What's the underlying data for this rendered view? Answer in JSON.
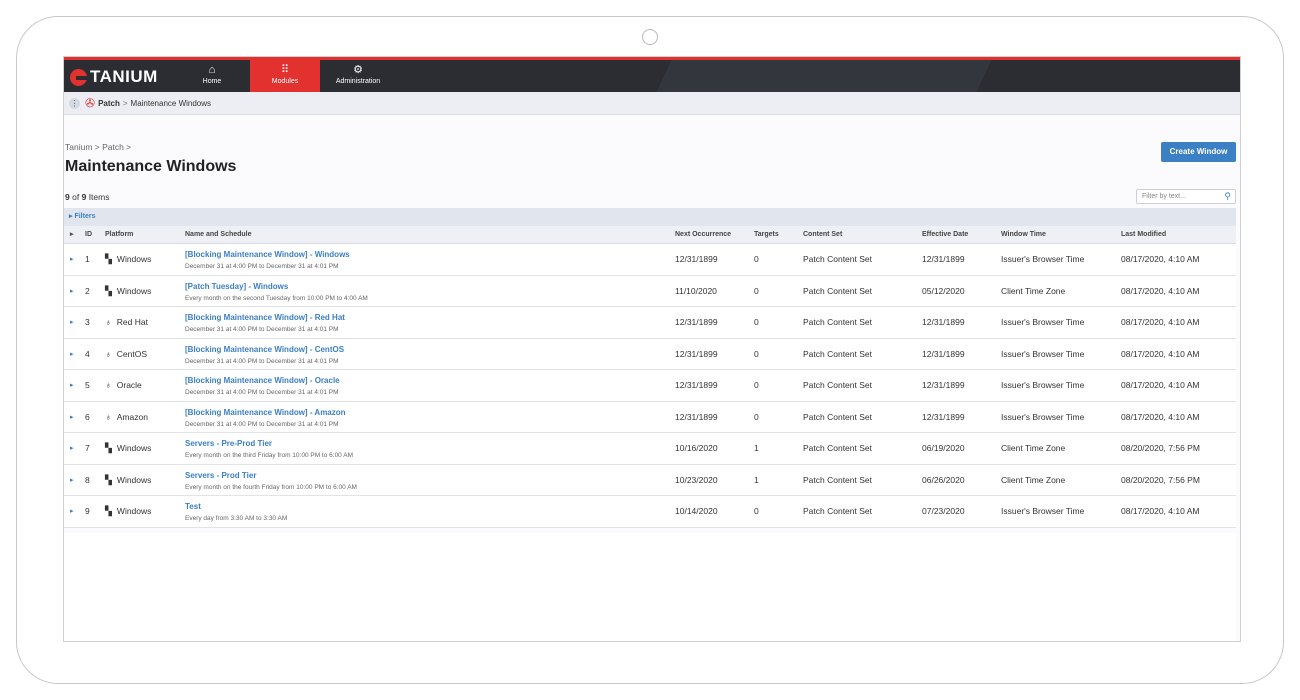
{
  "app": {
    "brand": "TANIUM"
  },
  "nav": [
    {
      "label": "Home",
      "icon": "home-icon",
      "glyph": "⌂"
    },
    {
      "label": "Modules",
      "icon": "grid-icon",
      "glyph": "⠿"
    },
    {
      "label": "Administration",
      "icon": "gears-icon",
      "glyph": "⚙"
    }
  ],
  "breadcrumb_bar": {
    "module": "Patch",
    "separator": ">",
    "page": "Maintenance Windows"
  },
  "page": {
    "breadcrumb": "Tanium > Patch >",
    "title": "Maintenance Windows",
    "create_button": "Create Window",
    "count_shown": "9",
    "count_of": "of",
    "count_total": "9",
    "count_suffix": "Items",
    "filter_placeholder": "Filter by text...",
    "filters_label": "▸ Filters"
  },
  "columns": [
    "ID",
    "Platform",
    "Name and Schedule",
    "Next Occurrence",
    "Targets",
    "Content Set",
    "Effective Date",
    "Window Time",
    "Last Modified"
  ],
  "rows": [
    {
      "id": "1",
      "platform": "Windows",
      "platform_icon": "windows-icon",
      "name": "[Blocking Maintenance Window] - Windows",
      "schedule": "December 31 at 4:00 PM to December 31 at 4:01 PM",
      "next": "12/31/1899",
      "targets": "0",
      "content_set": "Patch Content Set",
      "effective": "12/31/1899",
      "window_time": "Issuer's Browser Time",
      "modified": "08/17/2020, 4:10 AM"
    },
    {
      "id": "2",
      "platform": "Windows",
      "platform_icon": "windows-icon",
      "name": "[Patch Tuesday] - Windows",
      "schedule": "Every month on the second Tuesday from 10:00 PM to 4:00 AM",
      "next": "11/10/2020",
      "targets": "0",
      "content_set": "Patch Content Set",
      "effective": "05/12/2020",
      "window_time": "Client Time Zone",
      "modified": "08/17/2020, 4:10 AM"
    },
    {
      "id": "3",
      "platform": "Red Hat",
      "platform_icon": "linux-icon",
      "name": "[Blocking Maintenance Window] - Red Hat",
      "schedule": "December 31 at 4:00 PM to December 31 at 4:01 PM",
      "next": "12/31/1899",
      "targets": "0",
      "content_set": "Patch Content Set",
      "effective": "12/31/1899",
      "window_time": "Issuer's Browser Time",
      "modified": "08/17/2020, 4:10 AM"
    },
    {
      "id": "4",
      "platform": "CentOS",
      "platform_icon": "linux-icon",
      "name": "[Blocking Maintenance Window] - CentOS",
      "schedule": "December 31 at 4:00 PM to December 31 at 4:01 PM",
      "next": "12/31/1899",
      "targets": "0",
      "content_set": "Patch Content Set",
      "effective": "12/31/1899",
      "window_time": "Issuer's Browser Time",
      "modified": "08/17/2020, 4:10 AM"
    },
    {
      "id": "5",
      "platform": "Oracle",
      "platform_icon": "linux-icon",
      "name": "[Blocking Maintenance Window] - Oracle",
      "schedule": "December 31 at 4:00 PM to December 31 at 4:01 PM",
      "next": "12/31/1899",
      "targets": "0",
      "content_set": "Patch Content Set",
      "effective": "12/31/1899",
      "window_time": "Issuer's Browser Time",
      "modified": "08/17/2020, 4:10 AM"
    },
    {
      "id": "6",
      "platform": "Amazon",
      "platform_icon": "linux-icon",
      "name": "[Blocking Maintenance Window] - Amazon",
      "schedule": "December 31 at 4:00 PM to December 31 at 4:01 PM",
      "next": "12/31/1899",
      "targets": "0",
      "content_set": "Patch Content Set",
      "effective": "12/31/1899",
      "window_time": "Issuer's Browser Time",
      "modified": "08/17/2020, 4:10 AM"
    },
    {
      "id": "7",
      "platform": "Windows",
      "platform_icon": "windows-icon",
      "name": "Servers - Pre-Prod Tier",
      "schedule": "Every month on the third Friday from 10:00 PM to 6:00 AM",
      "next": "10/16/2020",
      "targets": "1",
      "content_set": "Patch Content Set",
      "effective": "06/19/2020",
      "window_time": "Client Time Zone",
      "modified": "08/20/2020, 7:56 PM"
    },
    {
      "id": "8",
      "platform": "Windows",
      "platform_icon": "windows-icon",
      "name": "Servers - Prod Tier",
      "schedule": "Every month on the fourth Friday from 10:00 PM to 6:00 AM",
      "next": "10/23/2020",
      "targets": "1",
      "content_set": "Patch Content Set",
      "effective": "06/26/2020",
      "window_time": "Client Time Zone",
      "modified": "08/20/2020, 7:56 PM"
    },
    {
      "id": "9",
      "platform": "Windows",
      "platform_icon": "windows-icon",
      "name": "Test",
      "schedule": "Every day from 3:30 AM to 3:30 AM",
      "next": "10/14/2020",
      "targets": "0",
      "content_set": "Patch Content Set",
      "effective": "07/23/2020",
      "window_time": "Issuer's Browser Time",
      "modified": "08/17/2020, 4:10 AM"
    }
  ],
  "colors": {
    "accent": "#e2312f",
    "link": "#3b7fc4",
    "nav_bg": "#2b2d33"
  }
}
